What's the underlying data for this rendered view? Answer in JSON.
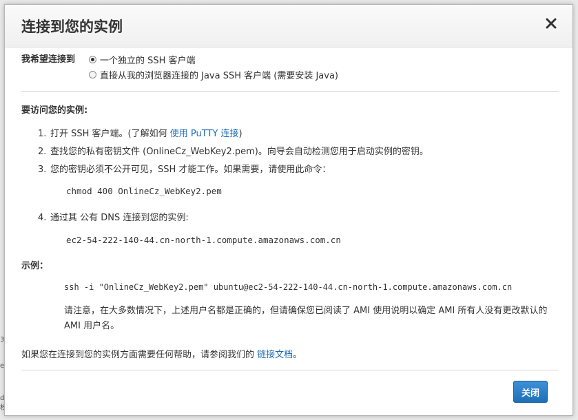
{
  "backdrop": {
    "stub_chars": [
      "3",
      "e",
      "d",
      "档"
    ]
  },
  "dialog": {
    "title": "连接到您的实例",
    "close_icon": "close-icon",
    "connect_heading": "我希望连接到",
    "options": [
      {
        "label": "一个独立的 SSH 客户端",
        "checked": true
      },
      {
        "label": "直接从我的浏览器连接的 Java SSH 客户端 (需要安装 Java)",
        "checked": false
      }
    ],
    "access_heading": "要访问您的实例:",
    "steps": [
      {
        "num": "1.",
        "prefix": "打开 SSH 客户端。(了解如何 ",
        "link": "使用 PuTTY 连接",
        "suffix": ")"
      },
      {
        "num": "2.",
        "text": "查找您的私有密钥文件 (OnlineCz_WebKey2.pem)。向导会自动检测您用于启动实例的密钥。"
      },
      {
        "num": "3.",
        "text": "您的密钥必须不公开可见，SSH 才能工作。如果需要，请使用此命令："
      },
      {
        "num": "4.",
        "text": "通过其 公有 DNS 连接到您的实例:"
      }
    ],
    "chmod_cmd": "chmod 400 OnlineCz_WebKey2.pem",
    "public_dns": "ec2-54-222-140-44.cn-north-1.compute.amazonaws.com.cn",
    "example_heading": "示例：",
    "ssh_cmd": "ssh -i \"OnlineCz_WebKey2.pem\" ubuntu@ec2-54-222-140-44.cn-north-1.compute.amazonaws.com.cn",
    "note": "请注意，在大多数情况下，上述用户名都是正确的，但请确保您已阅读了 AMI 使用说明以确定 AMI 所有人没有更改默认的 AMI 用户名。",
    "help_prefix": "如果您在连接到您的实例方面需要任何帮助，请参阅我们的 ",
    "help_link": "链接文档",
    "help_suffix": "。",
    "close_button": "关闭"
  },
  "colors": {
    "link": "#1b6ab3",
    "primary_button": "#1e6fb8"
  }
}
